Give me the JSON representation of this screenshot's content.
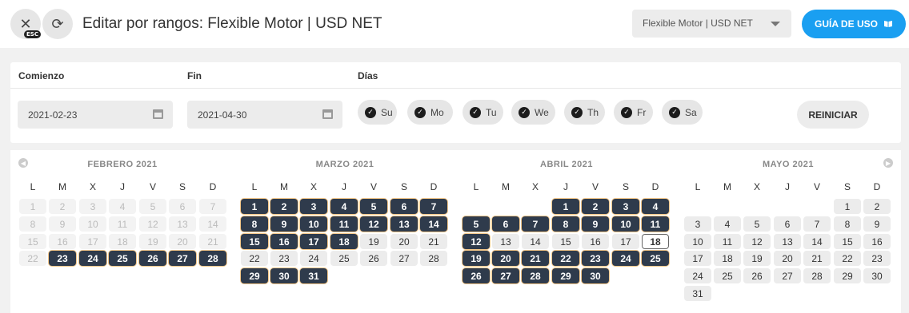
{
  "header": {
    "close_icon": "✕",
    "esc_badge": "ESC",
    "refresh_icon": "⟳",
    "title": "Editar por rangos: Flexible Motor | USD NET",
    "select_value": "Flexible Motor | USD NET",
    "guide_label": "GUÍA DE USO",
    "guide_icon": "book-icon",
    "accent_color": "#1a9ff1"
  },
  "form": {
    "start_label": "Comienzo",
    "end_label": "Fin",
    "days_label": "Días",
    "start_value": "2021-02-23",
    "end_value": "2021-04-30",
    "days": [
      "Su",
      "Mo",
      "Tu",
      "We",
      "Th",
      "Fr",
      "Sa"
    ],
    "reset_label": "REINICIAR"
  },
  "calendar": {
    "weekdays": [
      "L",
      "M",
      "X",
      "J",
      "V",
      "S",
      "D"
    ],
    "prev_icon": "◀",
    "next_icon": "▶",
    "months": [
      {
        "title": "FEBRERO 2021",
        "rows": [
          [
            {
              "d": "1",
              "s": "outside"
            },
            {
              "d": "2",
              "s": "outside"
            },
            {
              "d": "3",
              "s": "outside"
            },
            {
              "d": "4",
              "s": "outside"
            },
            {
              "d": "5",
              "s": "outside"
            },
            {
              "d": "6",
              "s": "outside"
            },
            {
              "d": "7",
              "s": "outside"
            }
          ],
          [
            {
              "d": "8",
              "s": "outside"
            },
            {
              "d": "9",
              "s": "outside"
            },
            {
              "d": "10",
              "s": "outside"
            },
            {
              "d": "11",
              "s": "outside"
            },
            {
              "d": "12",
              "s": "outside"
            },
            {
              "d": "13",
              "s": "outside"
            },
            {
              "d": "14",
              "s": "outside"
            }
          ],
          [
            {
              "d": "15",
              "s": "outside"
            },
            {
              "d": "16",
              "s": "outside"
            },
            {
              "d": "17",
              "s": "outside"
            },
            {
              "d": "18",
              "s": "outside"
            },
            {
              "d": "19",
              "s": "outside"
            },
            {
              "d": "20",
              "s": "outside"
            },
            {
              "d": "21",
              "s": "outside"
            }
          ],
          [
            {
              "d": "22",
              "s": "outside"
            },
            {
              "d": "23",
              "s": "selected"
            },
            {
              "d": "24",
              "s": "selected"
            },
            {
              "d": "25",
              "s": "selected"
            },
            {
              "d": "26",
              "s": "selected"
            },
            {
              "d": "27",
              "s": "selected"
            },
            {
              "d": "28",
              "s": "selected"
            }
          ]
        ]
      },
      {
        "title": "MARZO 2021",
        "rows": [
          [
            {
              "d": "1",
              "s": "selected"
            },
            {
              "d": "2",
              "s": "selected"
            },
            {
              "d": "3",
              "s": "selected"
            },
            {
              "d": "4",
              "s": "selected"
            },
            {
              "d": "5",
              "s": "selected"
            },
            {
              "d": "6",
              "s": "selected"
            },
            {
              "d": "7",
              "s": "selected"
            }
          ],
          [
            {
              "d": "8",
              "s": "selected"
            },
            {
              "d": "9",
              "s": "selected"
            },
            {
              "d": "10",
              "s": "selected"
            },
            {
              "d": "11",
              "s": "selected"
            },
            {
              "d": "12",
              "s": "selected"
            },
            {
              "d": "13",
              "s": "selected"
            },
            {
              "d": "14",
              "s": "selected"
            }
          ],
          [
            {
              "d": "15",
              "s": "selected"
            },
            {
              "d": "16",
              "s": "selected"
            },
            {
              "d": "17",
              "s": "selected"
            },
            {
              "d": "18",
              "s": "selected"
            },
            {
              "d": "19",
              "s": "normal"
            },
            {
              "d": "20",
              "s": "normal"
            },
            {
              "d": "21",
              "s": "normal"
            }
          ],
          [
            {
              "d": "22",
              "s": "normal"
            },
            {
              "d": "23",
              "s": "normal"
            },
            {
              "d": "24",
              "s": "normal"
            },
            {
              "d": "25",
              "s": "normal"
            },
            {
              "d": "26",
              "s": "normal"
            },
            {
              "d": "27",
              "s": "normal"
            },
            {
              "d": "28",
              "s": "normal"
            }
          ],
          [
            {
              "d": "29",
              "s": "selected"
            },
            {
              "d": "30",
              "s": "selected"
            },
            {
              "d": "31",
              "s": "selected"
            },
            null,
            null,
            null,
            null
          ]
        ]
      },
      {
        "title": "ABRIL 2021",
        "rows": [
          [
            null,
            null,
            null,
            {
              "d": "1",
              "s": "selected"
            },
            {
              "d": "2",
              "s": "selected"
            },
            {
              "d": "3",
              "s": "selected"
            },
            {
              "d": "4",
              "s": "selected"
            }
          ],
          [
            {
              "d": "5",
              "s": "selected"
            },
            {
              "d": "6",
              "s": "selected"
            },
            {
              "d": "7",
              "s": "selected"
            },
            {
              "d": "8",
              "s": "selected"
            },
            {
              "d": "9",
              "s": "selected"
            },
            {
              "d": "10",
              "s": "selected"
            },
            {
              "d": "11",
              "s": "selected"
            }
          ],
          [
            {
              "d": "12",
              "s": "selected"
            },
            {
              "d": "13",
              "s": "normal"
            },
            {
              "d": "14",
              "s": "normal"
            },
            {
              "d": "15",
              "s": "normal"
            },
            {
              "d": "16",
              "s": "normal"
            },
            {
              "d": "17",
              "s": "normal"
            },
            {
              "d": "18",
              "s": "today"
            }
          ],
          [
            {
              "d": "19",
              "s": "selected"
            },
            {
              "d": "20",
              "s": "selected"
            },
            {
              "d": "21",
              "s": "selected"
            },
            {
              "d": "22",
              "s": "selected"
            },
            {
              "d": "23",
              "s": "selected"
            },
            {
              "d": "24",
              "s": "selected"
            },
            {
              "d": "25",
              "s": "selected"
            }
          ],
          [
            {
              "d": "26",
              "s": "selected"
            },
            {
              "d": "27",
              "s": "selected"
            },
            {
              "d": "28",
              "s": "selected"
            },
            {
              "d": "29",
              "s": "selected"
            },
            {
              "d": "30",
              "s": "selected"
            },
            null,
            null
          ]
        ]
      },
      {
        "title": "MAYO 2021",
        "rows": [
          [
            null,
            null,
            null,
            null,
            null,
            {
              "d": "1",
              "s": "normal"
            },
            {
              "d": "2",
              "s": "normal"
            }
          ],
          [
            {
              "d": "3",
              "s": "normal"
            },
            {
              "d": "4",
              "s": "normal"
            },
            {
              "d": "5",
              "s": "normal"
            },
            {
              "d": "6",
              "s": "normal"
            },
            {
              "d": "7",
              "s": "normal"
            },
            {
              "d": "8",
              "s": "normal"
            },
            {
              "d": "9",
              "s": "normal"
            }
          ],
          [
            {
              "d": "10",
              "s": "normal"
            },
            {
              "d": "11",
              "s": "normal"
            },
            {
              "d": "12",
              "s": "normal"
            },
            {
              "d": "13",
              "s": "normal"
            },
            {
              "d": "14",
              "s": "normal"
            },
            {
              "d": "15",
              "s": "normal"
            },
            {
              "d": "16",
              "s": "normal"
            }
          ],
          [
            {
              "d": "17",
              "s": "normal"
            },
            {
              "d": "18",
              "s": "normal"
            },
            {
              "d": "19",
              "s": "normal"
            },
            {
              "d": "20",
              "s": "normal"
            },
            {
              "d": "21",
              "s": "normal"
            },
            {
              "d": "22",
              "s": "normal"
            },
            {
              "d": "23",
              "s": "normal"
            }
          ],
          [
            {
              "d": "24",
              "s": "normal"
            },
            {
              "d": "25",
              "s": "normal"
            },
            {
              "d": "26",
              "s": "normal"
            },
            {
              "d": "27",
              "s": "normal"
            },
            {
              "d": "28",
              "s": "normal"
            },
            {
              "d": "29",
              "s": "normal"
            },
            {
              "d": "30",
              "s": "normal"
            }
          ],
          [
            {
              "d": "31",
              "s": "normal"
            },
            null,
            null,
            null,
            null,
            null,
            null
          ]
        ]
      }
    ]
  }
}
